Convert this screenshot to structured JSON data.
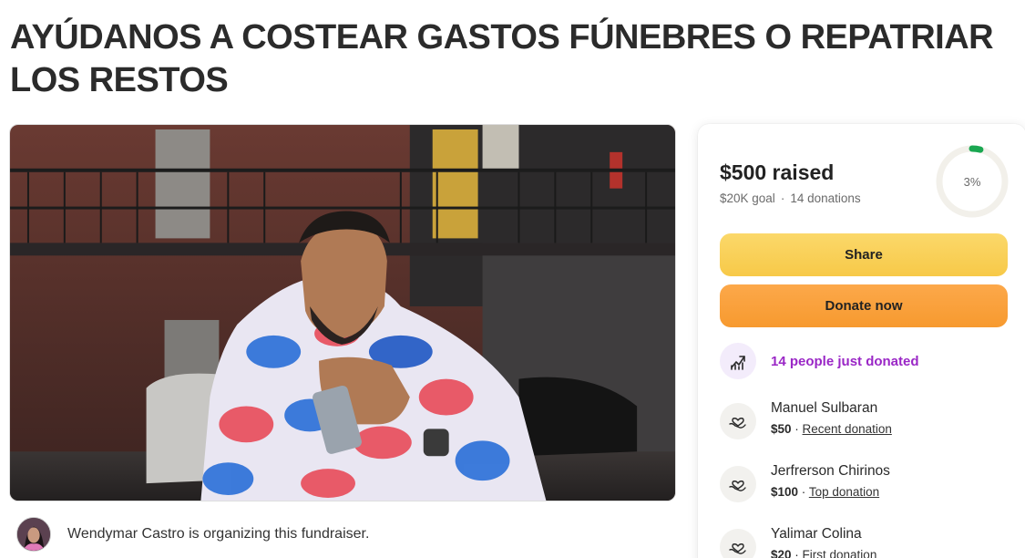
{
  "page_title": "AYÚDANOS A COSTEAR GASTOS FÚNEBRES O REPATRIAR LOS RESTOS",
  "organizer": {
    "text": "Wendymar Castro is organizing this fundraiser."
  },
  "donation_card": {
    "raised": "$500 raised",
    "goal": "$20K goal",
    "separator": "·",
    "donation_count": "14 donations",
    "progress_label": "3%",
    "progress_fraction": 0.03,
    "share_label": "Share",
    "donate_label": "Donate now",
    "activity_text": "14 people just donated",
    "donors": [
      {
        "name": "Manuel Sulbaran",
        "amount": "$50",
        "kind": "Recent donation"
      },
      {
        "name": "Jerfrerson Chirinos",
        "amount": "$100",
        "kind": "Top donation"
      },
      {
        "name": "Yalimar Colina",
        "amount": "$20",
        "kind": "First donation"
      }
    ]
  },
  "colors": {
    "share_button": "#f7c948",
    "donate_button": "#f79a2f",
    "progress_green": "#1aa751",
    "activity_purple": "#9a27c6"
  },
  "icons": {
    "activity": "trending-up-icon",
    "donor": "heart-hand-icon"
  }
}
